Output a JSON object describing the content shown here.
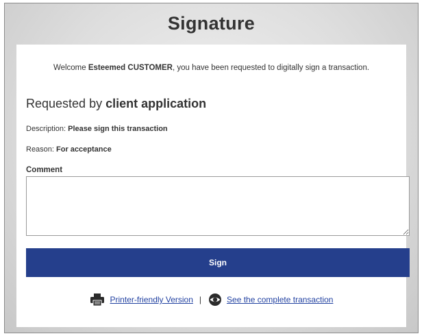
{
  "window": {
    "title": "Signature"
  },
  "welcome": {
    "prefix": "Welcome ",
    "customer_name": "Esteemed CUSTOMER",
    "suffix": ", you have been requested to digitally sign a transaction."
  },
  "request": {
    "prefix": "Requested by ",
    "requester": "client application",
    "description_label": "Description: ",
    "description_value": "Please sign this transaction",
    "reason_label": "Reason: ",
    "reason_value": "For acceptance"
  },
  "comment": {
    "label": "Comment",
    "value": "",
    "placeholder": ""
  },
  "actions": {
    "sign_label": "Sign"
  },
  "footer": {
    "printer_icon": "printer-icon",
    "printer_link": "Printer-friendly Version",
    "separator": "|",
    "eye_icon": "eye-icon",
    "transaction_link": "See the complete transaction"
  },
  "colors": {
    "primary_button": "#253f8c",
    "link": "#1f3fa0",
    "text": "#333333"
  }
}
